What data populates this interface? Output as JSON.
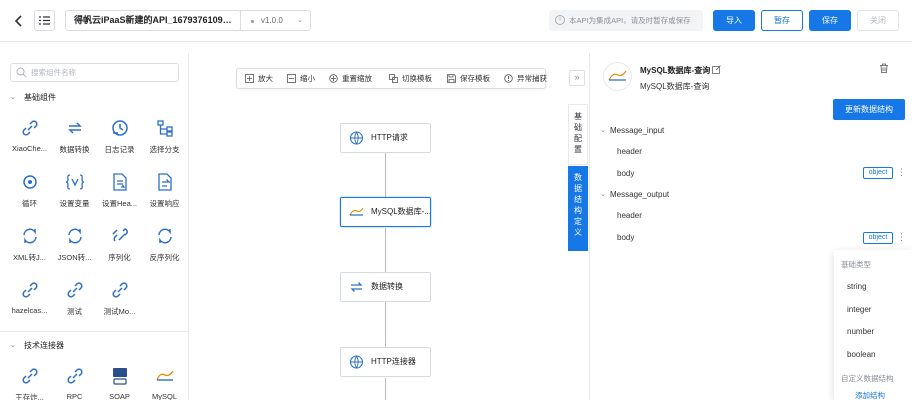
{
  "header": {
    "back_icon": "chevron-left-icon",
    "menu_icon": "list-icon",
    "title": "得帆云iPaaS新建的API_16793761097...",
    "version": "v1.0.0",
    "notice": "本API为集成API，请及时暂存或保存",
    "buttons": {
      "import": "导入",
      "stage": "暂存",
      "save": "保存",
      "close": "关闭"
    },
    "colors": {
      "primary": "#1677e6"
    }
  },
  "left_panel": {
    "search_placeholder": "搜索组件名称",
    "sections": [
      {
        "title": "基础组件",
        "items": [
          {
            "label": "XiaoChe...",
            "icon": "link-icon"
          },
          {
            "label": "数据转换",
            "icon": "transform-icon"
          },
          {
            "label": "日志记录",
            "icon": "log-icon"
          },
          {
            "label": "选择分支",
            "icon": "branch-icon"
          },
          {
            "label": "循环",
            "icon": "loop-icon"
          },
          {
            "label": "设置变量",
            "icon": "variable-icon"
          },
          {
            "label": "设置Hea...",
            "icon": "header-icon"
          },
          {
            "label": "设置响应",
            "icon": "response-icon"
          },
          {
            "label": "XML转J...",
            "icon": "convert-icon"
          },
          {
            "label": "JSON转...",
            "icon": "convert-icon"
          },
          {
            "label": "序列化",
            "icon": "serialize-icon"
          },
          {
            "label": "反序列化",
            "icon": "deserialize-icon"
          },
          {
            "label": "hazelcas...",
            "icon": "link-icon"
          },
          {
            "label": "测试",
            "icon": "link-icon"
          },
          {
            "label": "测试Mo...",
            "icon": "link-icon"
          }
        ]
      },
      {
        "title": "技术连接器",
        "items": [
          {
            "label": "王存炸...",
            "icon": "link-icon"
          },
          {
            "label": "RPC",
            "icon": "link-icon"
          },
          {
            "label": "SOAP",
            "icon": "soap-icon"
          },
          {
            "label": "MySQL",
            "icon": "mysql-icon"
          }
        ]
      }
    ]
  },
  "canvas": {
    "toolbar": [
      {
        "label": "放大",
        "icon": "zoom-in-icon"
      },
      {
        "label": "缩小",
        "icon": "zoom-out-icon"
      },
      {
        "label": "重置缩放",
        "icon": "reset-zoom-icon"
      },
      {
        "label": "切换模板",
        "icon": "switch-template-icon"
      },
      {
        "label": "保存模板",
        "icon": "save-template-icon"
      },
      {
        "label": "异常捕获",
        "icon": "exception-icon"
      }
    ],
    "collapse_icon": "double-chevron-right-icon",
    "nodes": [
      {
        "label": "HTTP请求",
        "icon": "http-icon"
      },
      {
        "label": "MySQL数据库-...",
        "icon": "mysql-icon",
        "selected": true
      },
      {
        "label": "数据转换",
        "icon": "transform-icon"
      },
      {
        "label": "HTTP连接器",
        "icon": "http-icon"
      }
    ]
  },
  "side_tabs": [
    {
      "label": "基础配置",
      "active": false
    },
    {
      "label": "数据结构定义",
      "active": true
    }
  ],
  "right_panel": {
    "title": "MySQL数据库-查询",
    "subtitle": "MySQL数据库-查询",
    "update_button": "更新数据结构",
    "message_input": {
      "label": "Message_input",
      "children": [
        {
          "label": "header"
        },
        {
          "label": "body",
          "type": "object"
        }
      ]
    },
    "message_output": {
      "label": "Message_output",
      "children": [
        {
          "label": "header"
        },
        {
          "label": "body",
          "type": "object"
        }
      ]
    }
  },
  "type_dropdown": {
    "group_basic": "基础类型",
    "basic": [
      "string",
      "integer",
      "number",
      "boolean"
    ],
    "group_custom": "自定义数据结构",
    "add_label": "添加结构"
  }
}
